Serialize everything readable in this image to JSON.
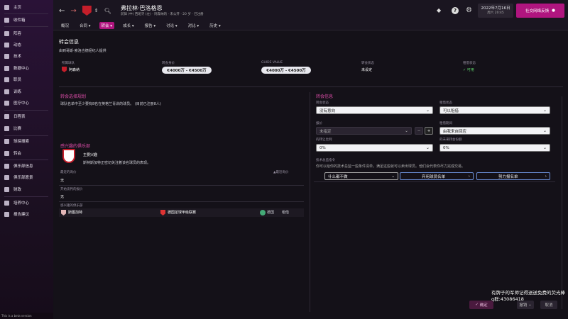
{
  "sidebar": {
    "items": [
      {
        "label": "主页",
        "icon": "home-icon"
      },
      {
        "label": "收件箱",
        "icon": "inbox-icon"
      },
      {
        "label": "阵容",
        "icon": "squad-icon"
      },
      {
        "label": "动态",
        "icon": "dynamics-icon"
      },
      {
        "label": "技术",
        "icon": "tactics-icon"
      },
      {
        "label": "数据中心",
        "icon": "data-hub-icon"
      },
      {
        "label": "职员",
        "icon": "staff-icon"
      },
      {
        "label": "训练",
        "icon": "training-icon"
      },
      {
        "label": "医疗中心",
        "icon": "medical-icon"
      },
      {
        "label": "日程表",
        "icon": "schedule-icon"
      },
      {
        "label": "比赛",
        "icon": "competitions-icon"
      },
      {
        "label": "球探搜索",
        "icon": "scouting-icon"
      },
      {
        "label": "转会",
        "icon": "transfers-icon"
      },
      {
        "label": "俱乐部信息",
        "icon": "club-info-icon"
      },
      {
        "label": "俱乐部愿景",
        "icon": "club-vision-icon"
      },
      {
        "label": "财政",
        "icon": "finances-icon"
      },
      {
        "label": "培养中心",
        "icon": "development-icon"
      },
      {
        "label": "报告建议",
        "icon": "report-icon"
      }
    ],
    "beta": "This is a beta version"
  },
  "header": {
    "player_name": "弗拉林·巴洛格恩",
    "player_sub": "前锋 (中) 西班牙 (左) · 阿森纳的 · 未公开 · 20 岁 · 已注册",
    "date": "2022年7月16日",
    "day": "周六 20:45",
    "social_btn": "社交网络反馈"
  },
  "tabs": [
    "概况",
    "合同",
    "转会",
    "成长",
    "报告",
    "讨论",
    "对比",
    "历史"
  ],
  "transfer_info": {
    "title": "转会信息",
    "subtitle": "由到哥斯·索洛古德经纪人提供",
    "cols": [
      {
        "label": "所属球队",
        "value": "阿森纳"
      },
      {
        "label": "转会身价",
        "value": "€4000万 - €4500万"
      },
      {
        "label": "GUIDE VALUE",
        "value": "€4000万 - €4500万"
      },
      {
        "label": "转会状态",
        "value": "未设定"
      },
      {
        "label": "租借状态",
        "value": "可用"
      }
    ]
  },
  "plans": {
    "title": "转会选择规划",
    "text": "球队名单中至少要有8名在英格兰青训的球员。 (目前已注册8人)"
  },
  "interested": {
    "title": "感兴趣的俱乐部",
    "main_label": "主要兴趣",
    "main_text": "斯特斯加特正密切关注着该名球员的表现。",
    "rows": [
      {
        "header": "最近的询价",
        "right": "▲最近询价",
        "value": "无"
      },
      {
        "header": "开始谈判的报价",
        "value": "无"
      },
      {
        "header": "感兴趣的俱乐部",
        "club": "斯图加特",
        "league": "德国足球甲级联赛",
        "nation": "德国",
        "status": "租借"
      }
    ]
  },
  "transfer_settings": {
    "title": "转会信息",
    "fields": [
      {
        "label": "转会状态",
        "value": "没有意向"
      },
      {
        "label": "租借状态",
        "value": "可以租借"
      },
      {
        "label": "报价",
        "value": "未指定"
      },
      {
        "label": "租借期间",
        "value": "由我来自回应"
      },
      {
        "label": "的转让比例",
        "value": "0%"
      },
      {
        "label": "的未来转会份额",
        "value": "0%"
      }
    ],
    "tip_header": "技术总监指令",
    "tip_text": "你可以给你的技术总监一些条件清单，满足这些就可以卖出球员。他们会代表你尽力完成交易。",
    "buttons": [
      "什么都不做",
      "弃用球员名单",
      "努力报名单"
    ]
  },
  "bottom": {
    "confirm": "确定",
    "cancel": "撤销",
    "close": "取消"
  },
  "overlay": {
    "line1": "有牌子的军师记得送送免费的荧光棒",
    "line2": "q群:43086418"
  }
}
